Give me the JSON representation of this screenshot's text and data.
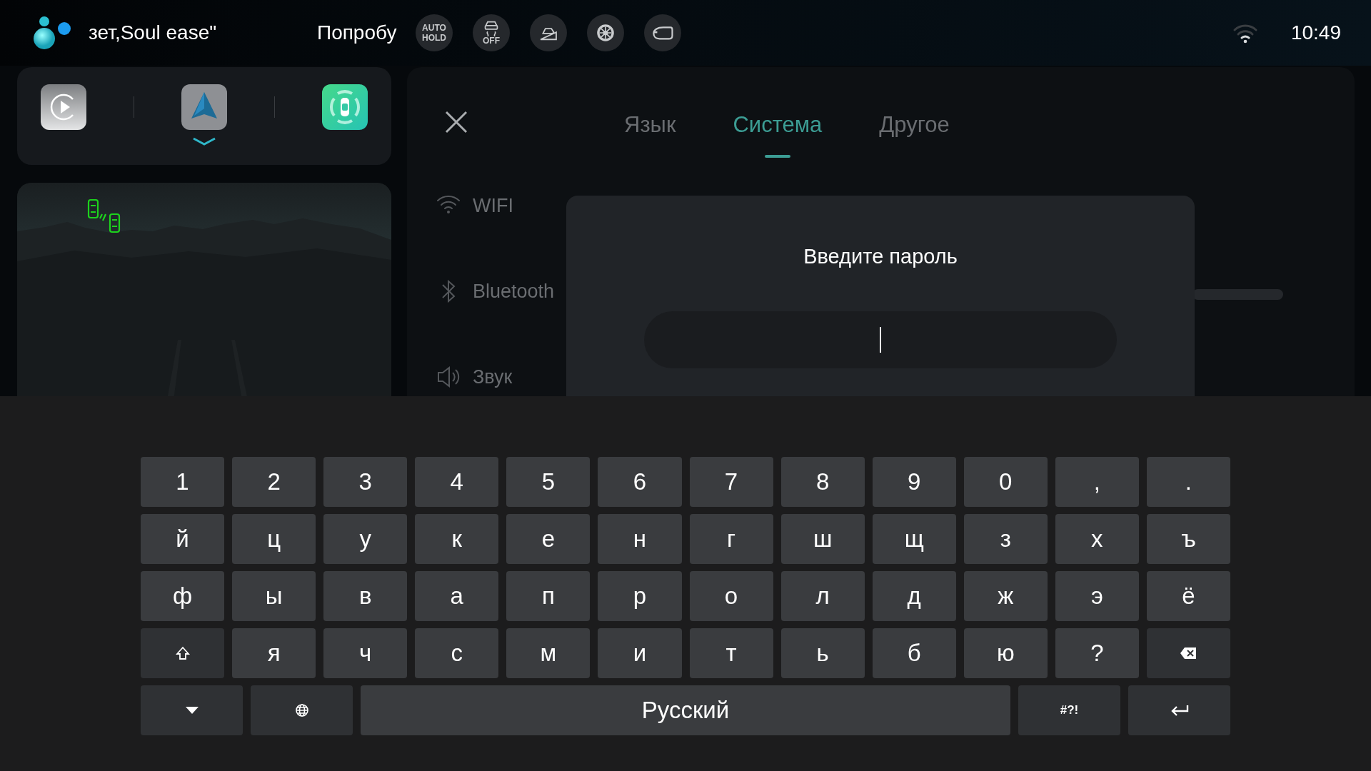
{
  "status_bar": {
    "assistant_text": "зет,Soul ease\"",
    "marquee_text": "Попробу",
    "quick_buttons": [
      {
        "kind": "auto-hold",
        "label": "AUTO HOLD"
      },
      {
        "kind": "traction",
        "label": "OFF"
      },
      {
        "kind": "hill"
      },
      {
        "kind": "tire"
      },
      {
        "kind": "mirror"
      }
    ],
    "time": "10:49"
  },
  "app_dock": {
    "apps": [
      {
        "kind": "play",
        "selected": false
      },
      {
        "kind": "navigation",
        "selected": true
      },
      {
        "kind": "parking",
        "selected": false
      }
    ]
  },
  "settings": {
    "tabs": [
      {
        "label": "Язык",
        "selected": false
      },
      {
        "label": "Система",
        "selected": true
      },
      {
        "label": "Другое",
        "selected": false
      }
    ],
    "menu": [
      {
        "kind": "wifi",
        "label": "WIFI"
      },
      {
        "kind": "bluetooth",
        "label": "Bluetooth"
      },
      {
        "kind": "sound",
        "label": "Звук"
      }
    ]
  },
  "dialog": {
    "title": "Введите пароль",
    "password_field": {
      "focused": true
    }
  },
  "keyboard": {
    "rows": [
      [
        {
          "kind": "char",
          "label": "1"
        },
        {
          "kind": "char",
          "label": "2"
        },
        {
          "kind": "char",
          "label": "3"
        },
        {
          "kind": "char",
          "label": "4"
        },
        {
          "kind": "char",
          "label": "5"
        },
        {
          "kind": "char",
          "label": "6"
        },
        {
          "kind": "char",
          "label": "7"
        },
        {
          "kind": "char",
          "label": "8"
        },
        {
          "kind": "char",
          "label": "9"
        },
        {
          "kind": "char",
          "label": "0"
        },
        {
          "kind": "char",
          "label": ","
        },
        {
          "kind": "char",
          "label": "."
        }
      ],
      [
        {
          "kind": "char",
          "label": "й"
        },
        {
          "kind": "char",
          "label": "ц"
        },
        {
          "kind": "char",
          "label": "у"
        },
        {
          "kind": "char",
          "label": "к"
        },
        {
          "kind": "char",
          "label": "е"
        },
        {
          "kind": "char",
          "label": "н"
        },
        {
          "kind": "char",
          "label": "г"
        },
        {
          "kind": "char",
          "label": "ш"
        },
        {
          "kind": "char",
          "label": "щ"
        },
        {
          "kind": "char",
          "label": "з"
        },
        {
          "kind": "char",
          "label": "х"
        },
        {
          "kind": "char",
          "label": "ъ"
        }
      ],
      [
        {
          "kind": "char",
          "label": "ф"
        },
        {
          "kind": "char",
          "label": "ы"
        },
        {
          "kind": "char",
          "label": "в"
        },
        {
          "kind": "char",
          "label": "а"
        },
        {
          "kind": "char",
          "label": "п"
        },
        {
          "kind": "char",
          "label": "р"
        },
        {
          "kind": "char",
          "label": "о"
        },
        {
          "kind": "char",
          "label": "л"
        },
        {
          "kind": "char",
          "label": "д"
        },
        {
          "kind": "char",
          "label": "ж"
        },
        {
          "kind": "char",
          "label": "э"
        },
        {
          "kind": "char",
          "label": "ё"
        }
      ],
      [
        {
          "kind": "shift"
        },
        {
          "kind": "char",
          "label": "я"
        },
        {
          "kind": "char",
          "label": "ч"
        },
        {
          "kind": "char",
          "label": "с"
        },
        {
          "kind": "char",
          "label": "м"
        },
        {
          "kind": "char",
          "label": "и"
        },
        {
          "kind": "char",
          "label": "т"
        },
        {
          "kind": "char",
          "label": "ь"
        },
        {
          "kind": "char",
          "label": "б"
        },
        {
          "kind": "char",
          "label": "ю"
        },
        {
          "kind": "char",
          "label": "?"
        },
        {
          "kind": "backspace"
        }
      ]
    ],
    "bottom_row": [
      {
        "kind": "hide"
      },
      {
        "kind": "globe"
      },
      {
        "kind": "space",
        "label": "Русский"
      },
      {
        "kind": "symbols",
        "label": "#?!"
      },
      {
        "kind": "enter"
      }
    ]
  }
}
